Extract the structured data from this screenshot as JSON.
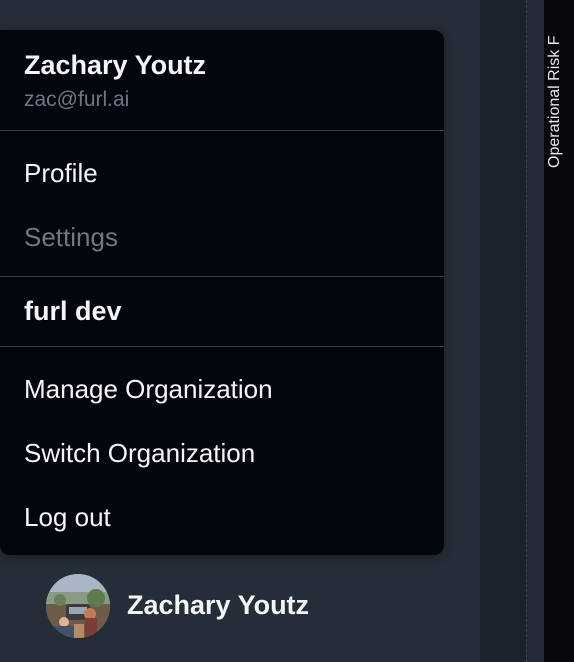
{
  "user": {
    "name": "Zachary Youtz",
    "email": "zac@furl.ai"
  },
  "menu": {
    "profile_label": "Profile",
    "settings_label": "Settings",
    "org_name": "furl dev",
    "manage_org_label": "Manage Organization",
    "switch_org_label": "Switch Organization",
    "logout_label": "Log out"
  },
  "sidebar": {
    "user_chip_name": "Zachary Youtz"
  },
  "right_panel": {
    "vertical_label": "Operational Risk F"
  },
  "colors": {
    "page_bg": "#252d38",
    "menu_bg": "#04060d",
    "text_primary": "#f3f5f8",
    "text_muted": "#6f7785",
    "separator": "#343c48"
  }
}
